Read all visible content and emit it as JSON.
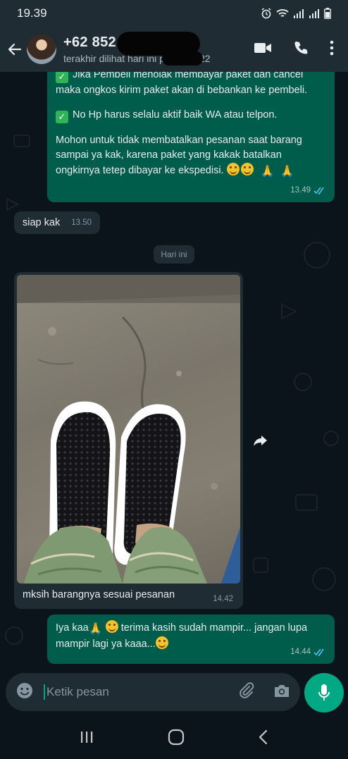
{
  "status_bar": {
    "time": "19.39"
  },
  "header": {
    "contact_name": "+62 852",
    "last_seen": "terakhir dilihat hari ini pukul 19.22"
  },
  "messages": {
    "outgoing_1": {
      "lines": [
        "Jika Pembeli menolak membayar paket dan cancel maka ongkos kirim paket akan di bebankan ke pembeli.",
        "No Hp harus selalu aktif baik WA atau telpon.",
        "Mohon untuk tidak membatalkan pesanan saat barang sampai ya kak, karena paket yang kakak batalkan ongkirnya tetep dibayar ke ekspedisi."
      ],
      "time": "13.49"
    },
    "incoming_1": {
      "text": "siap kak",
      "time": "13.50"
    },
    "day_chip": "Hari ini",
    "incoming_photo": {
      "caption": "mksih barangnya sesuai pesanan",
      "time": "14.42"
    },
    "outgoing_2": {
      "text_a": "Iya kaa",
      "text_b": "terima kasih sudah mampir... jangan lupa mampir lagi ya kaaa...",
      "time": "14.44"
    }
  },
  "input": {
    "placeholder": "Ketik pesan"
  },
  "colors": {
    "outgoing_bubble": "#005c4b",
    "incoming_bubble": "#1f2c34",
    "accent": "#00a884",
    "read_ticks": "#53bdeb"
  }
}
